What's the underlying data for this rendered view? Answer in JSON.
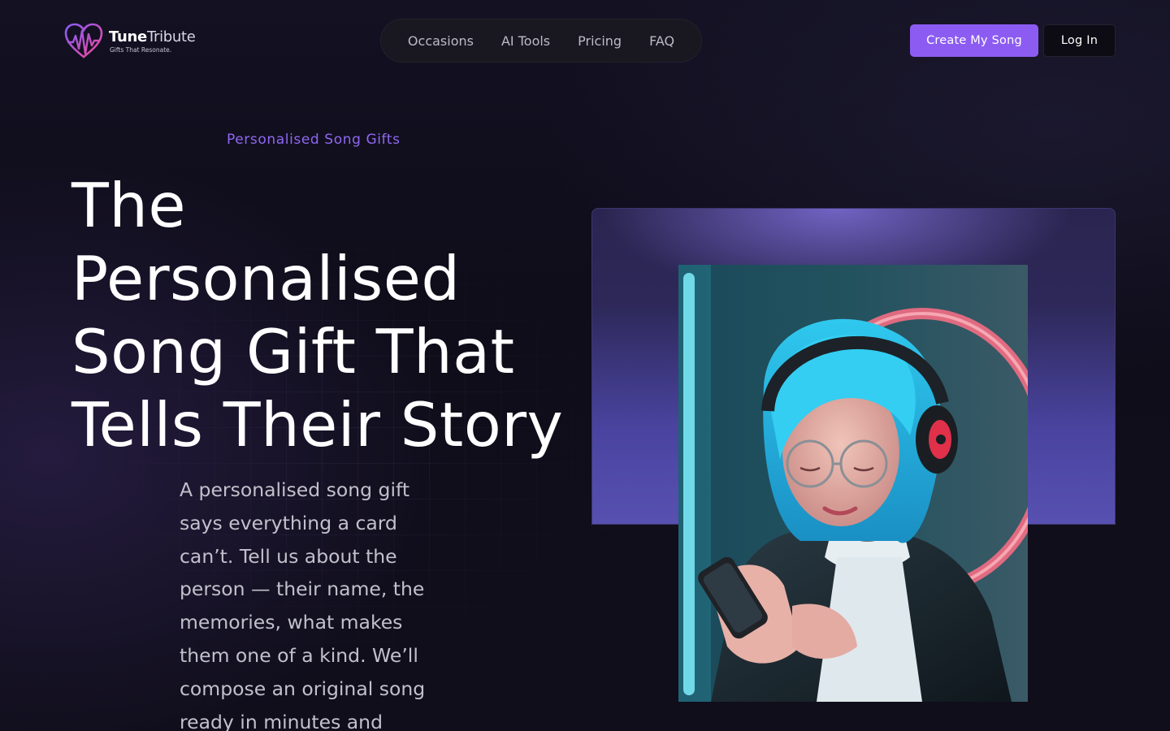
{
  "brand": {
    "name_bold": "Tune",
    "name_light": "Tribute",
    "tagline": "Gifts That Resonate.",
    "logo_icon": "heart-soundwave-icon"
  },
  "nav": {
    "items": [
      {
        "label": "Occasions"
      },
      {
        "label": "AI Tools"
      },
      {
        "label": "Pricing"
      },
      {
        "label": "FAQ"
      }
    ]
  },
  "header_actions": {
    "create_label": "Create My Song",
    "login_label": "Log In"
  },
  "hero": {
    "eyebrow": "Personalised Song Gifts",
    "headline": "The Personalised Song Gift That Tells Their Story",
    "body": "A personalised song gift says everything a card can’t. Tell us about the person — their name, the memories, what makes them one of a kind. We’ll compose an original song ready in minutes and"
  },
  "colors": {
    "accent": "#8c5cf2",
    "eyebrow": "#8f67f0",
    "background": "#0e0c17",
    "card_gradient_end": "#5750b0"
  }
}
